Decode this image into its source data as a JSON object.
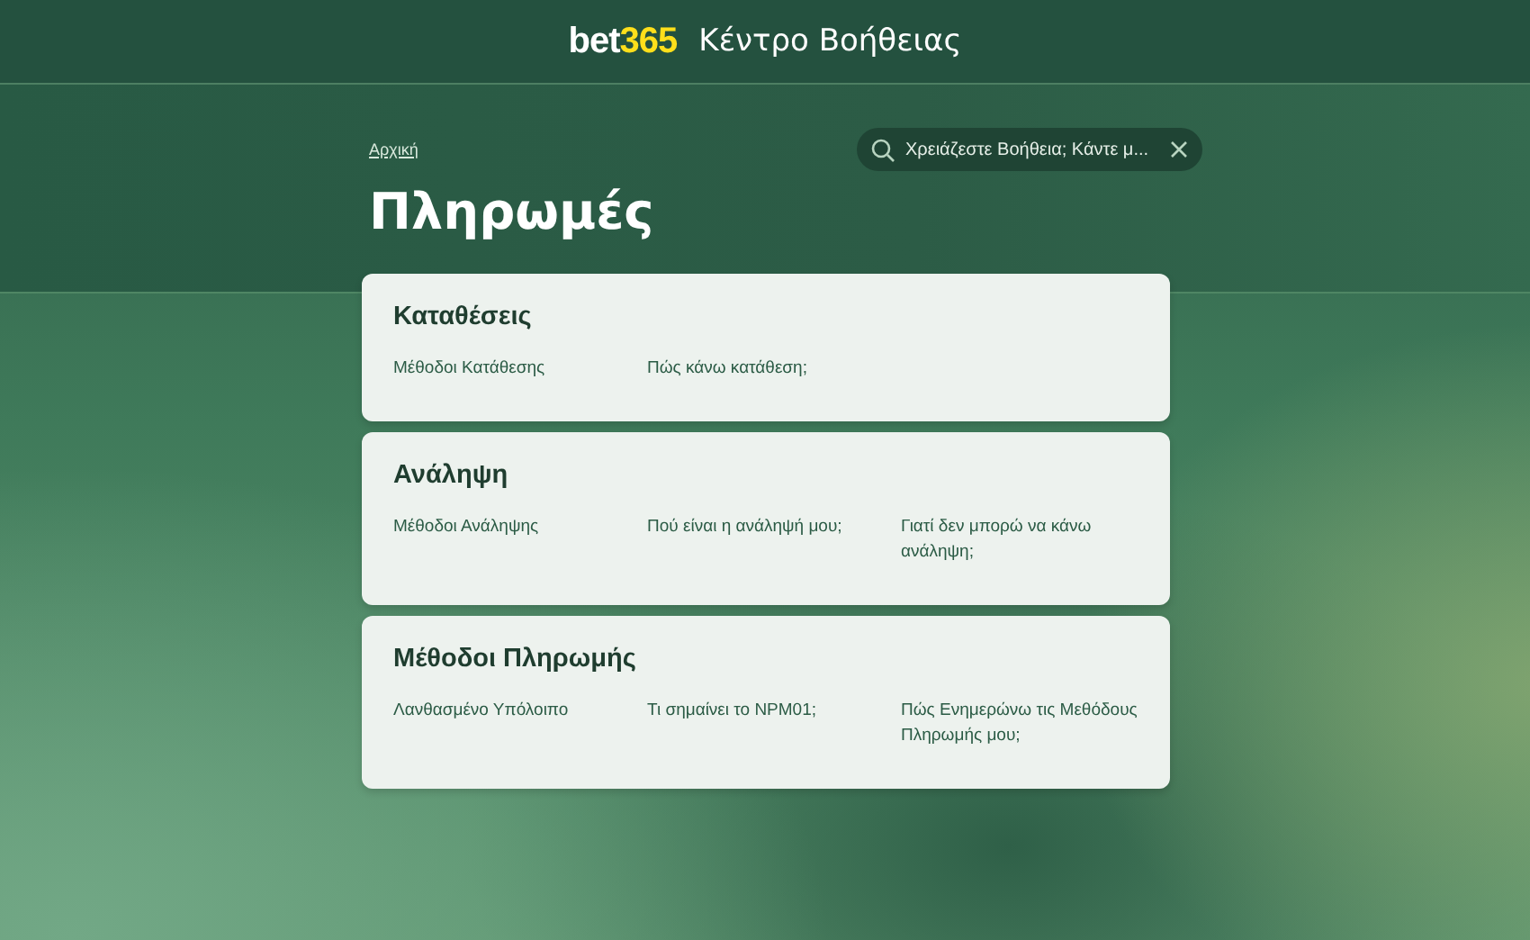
{
  "header": {
    "logo": {
      "prefix": "bet",
      "suffix": "365"
    },
    "title": "Κέντρο Βοήθειας"
  },
  "breadcrumb": "Αρχική",
  "search": {
    "placeholder": "Χρειάζεστε Βοήθεια; Κάντε μ..."
  },
  "page_title": "Πληρωμές",
  "sections": [
    {
      "title": "Καταθέσεις",
      "links": [
        "Μέθοδοι Κατάθεσης",
        "Πώς κάνω κατάθεση;"
      ]
    },
    {
      "title": "Ανάληψη",
      "links": [
        "Μέθοδοι Ανάληψης",
        "Πού είναι η ανάληψή μου;",
        "Γιατί δεν μπορώ να κάνω ανάληψη;"
      ]
    },
    {
      "title": "Μέθοδοι Πληρωμής",
      "links": [
        "Λανθασμένο Υπόλοιπο",
        "Τι σημαίνει το NPM01;",
        "Πώς Ενημερώνω τις Μεθόδους Πληρωμής μου;"
      ]
    }
  ]
}
